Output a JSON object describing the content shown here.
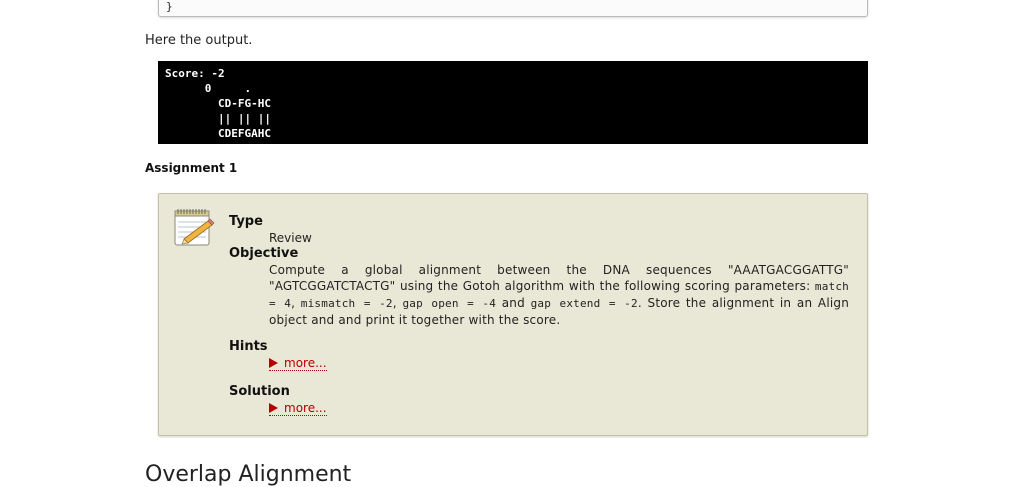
{
  "code_box": {
    "closing_brace": "}"
  },
  "intro_text": "Here the output.",
  "console": {
    "lines": [
      "Score: -2",
      "      0     .",
      "        CD-FG-HC",
      "        || || ||",
      "        CDEFGAHC"
    ]
  },
  "assignment": {
    "heading": "Assignment 1",
    "icon": "notepad-pencil-icon",
    "type_label": "Type",
    "type_value": "Review",
    "objective_label": "Objective",
    "objective_part1": "Compute a global alignment between the DNA sequences \"AAATGACGGATTG\" \"AGTCGGATCTACTG\" using the Gotoh algorithm with the following scoring parameters: ",
    "param_match": "match = 4",
    "param_mismatch": "mismatch = -2",
    "param_gap_open": "gap open = -4",
    "and_text": " and ",
    "param_gap_extend": "gap extend = -2",
    "objective_part2": "Store the alignment in an Align object and and print it together with the score.",
    "hints_label": "Hints",
    "hints_more": "more...",
    "solution_label": "Solution",
    "solution_more": "more..."
  },
  "next_section_heading": "Overlap Alignment",
  "colors": {
    "panel_bg": "#e9e8d6",
    "console_bg": "#000000",
    "link_red": "#b30000"
  }
}
